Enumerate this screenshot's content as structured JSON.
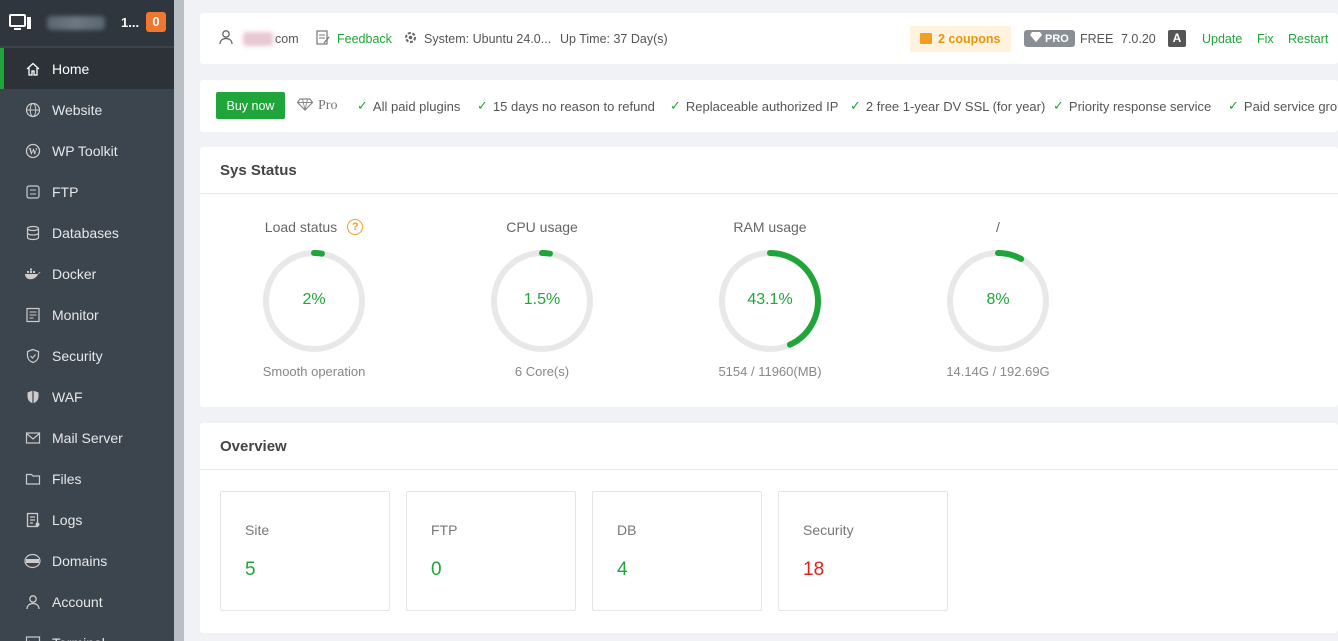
{
  "sidebar": {
    "host_suffix": "1...",
    "badge": "0",
    "items": [
      {
        "label": "Home",
        "icon": "home-icon",
        "active": true
      },
      {
        "label": "Website",
        "icon": "globe-icon"
      },
      {
        "label": "WP Toolkit",
        "icon": "wordpress-icon"
      },
      {
        "label": "FTP",
        "icon": "ftp-icon"
      },
      {
        "label": "Databases",
        "icon": "database-icon"
      },
      {
        "label": "Docker",
        "icon": "docker-icon"
      },
      {
        "label": "Monitor",
        "icon": "monitor-icon"
      },
      {
        "label": "Security",
        "icon": "shield-icon"
      },
      {
        "label": "WAF",
        "icon": "waf-shield-icon"
      },
      {
        "label": "Mail Server",
        "icon": "mail-icon"
      },
      {
        "label": "Files",
        "icon": "folder-icon"
      },
      {
        "label": "Logs",
        "icon": "logs-icon"
      },
      {
        "label": "Domains",
        "icon": "domains-icon"
      },
      {
        "label": "Account",
        "icon": "user-icon"
      },
      {
        "label": "Terminal",
        "icon": "terminal-icon"
      }
    ]
  },
  "topbar": {
    "user_suffix": "com",
    "feedback": "Feedback",
    "system": "System: Ubuntu 24.0...",
    "uptime": "Up Time: 37 Day(s)",
    "coupons": "2 coupons",
    "pro": "PRO",
    "free": "FREE",
    "version": "7.0.20",
    "update": "Update",
    "fix": "Fix",
    "restart": "Restart"
  },
  "benefits": {
    "buy": "Buy now",
    "pro": "Pro",
    "items": [
      "All paid plugins",
      "15 days no reason to refund",
      "Replaceable authorized IP",
      "2 free 1-year DV SSL (for year)",
      "Priority response service",
      "Paid service grou"
    ]
  },
  "sys_status": {
    "title": "Sys Status",
    "gauges": [
      {
        "title": "Load status",
        "value": "2%",
        "fraction": 0.02,
        "sub": "Smooth operation",
        "help": "?"
      },
      {
        "title": "CPU usage",
        "value": "1.5%",
        "fraction": 0.015,
        "sub": "6 Core(s)"
      },
      {
        "title": "RAM usage",
        "value": "43.1%",
        "fraction": 0.431,
        "sub": "5154 / 11960(MB)"
      },
      {
        "title": "/",
        "value": "8%",
        "fraction": 0.08,
        "sub": "14.14G / 192.69G"
      }
    ]
  },
  "overview": {
    "title": "Overview",
    "cards": [
      {
        "label": "Site",
        "value": "5"
      },
      {
        "label": "FTP",
        "value": "0"
      },
      {
        "label": "DB",
        "value": "4"
      },
      {
        "label": "Security",
        "value": "18",
        "alert": true
      }
    ]
  },
  "colors": {
    "accent": "#20a53a",
    "sidebar": "#3c444d",
    "alert": "#e0211b",
    "coupon": "#e8960a"
  }
}
